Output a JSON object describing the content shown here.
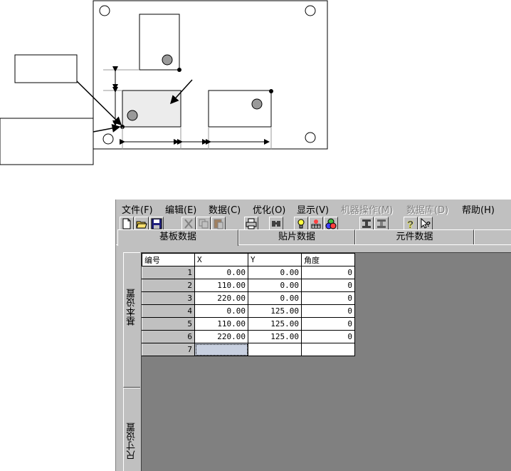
{
  "menu": {
    "items": [
      {
        "label": "文件(F)",
        "enabled": true
      },
      {
        "label": "编辑(E)",
        "enabled": true
      },
      {
        "label": "数据(C)",
        "enabled": true
      },
      {
        "label": "优化(O)",
        "enabled": true
      },
      {
        "label": "显示(V)",
        "enabled": true
      },
      {
        "label": "机器操作(M)",
        "enabled": false
      },
      {
        "label": "数据库(D)",
        "enabled": false
      },
      {
        "label": "帮助(H)",
        "enabled": true
      }
    ]
  },
  "toolbar": {
    "buttons": [
      "new-file-icon",
      "open-folder-icon",
      "save-icon",
      "cut-icon",
      "copy-icon",
      "paste-icon",
      "print-icon",
      "find-icon",
      "bulb-icon",
      "grid-icon",
      "shapes-icon",
      "align-left-icon",
      "align-right-icon",
      "help-icon",
      "context-help-icon"
    ]
  },
  "tabs": {
    "items": [
      "基板数据",
      "贴片数据",
      "元件数据"
    ],
    "active": "基板数据"
  },
  "side_tabs": {
    "basic": "基本设置",
    "size": "尺寸设置"
  },
  "grid": {
    "columns": [
      "编号",
      "X",
      "Y",
      "角度"
    ],
    "rows": [
      [
        "1",
        "0.00",
        "0.00",
        "0"
      ],
      [
        "2",
        "110.00",
        "0.00",
        "0"
      ],
      [
        "3",
        "220.00",
        "0.00",
        "0"
      ],
      [
        "4",
        "0.00",
        "125.00",
        "0"
      ],
      [
        "5",
        "110.00",
        "125.00",
        "0"
      ],
      [
        "6",
        "220.00",
        "125.00",
        "0"
      ],
      [
        "7",
        "",
        "",
        ""
      ]
    ]
  },
  "colors": {
    "window_face": "#c0c0c0",
    "grid_background": "#808080",
    "selected_cell": "#c8d0e0"
  }
}
